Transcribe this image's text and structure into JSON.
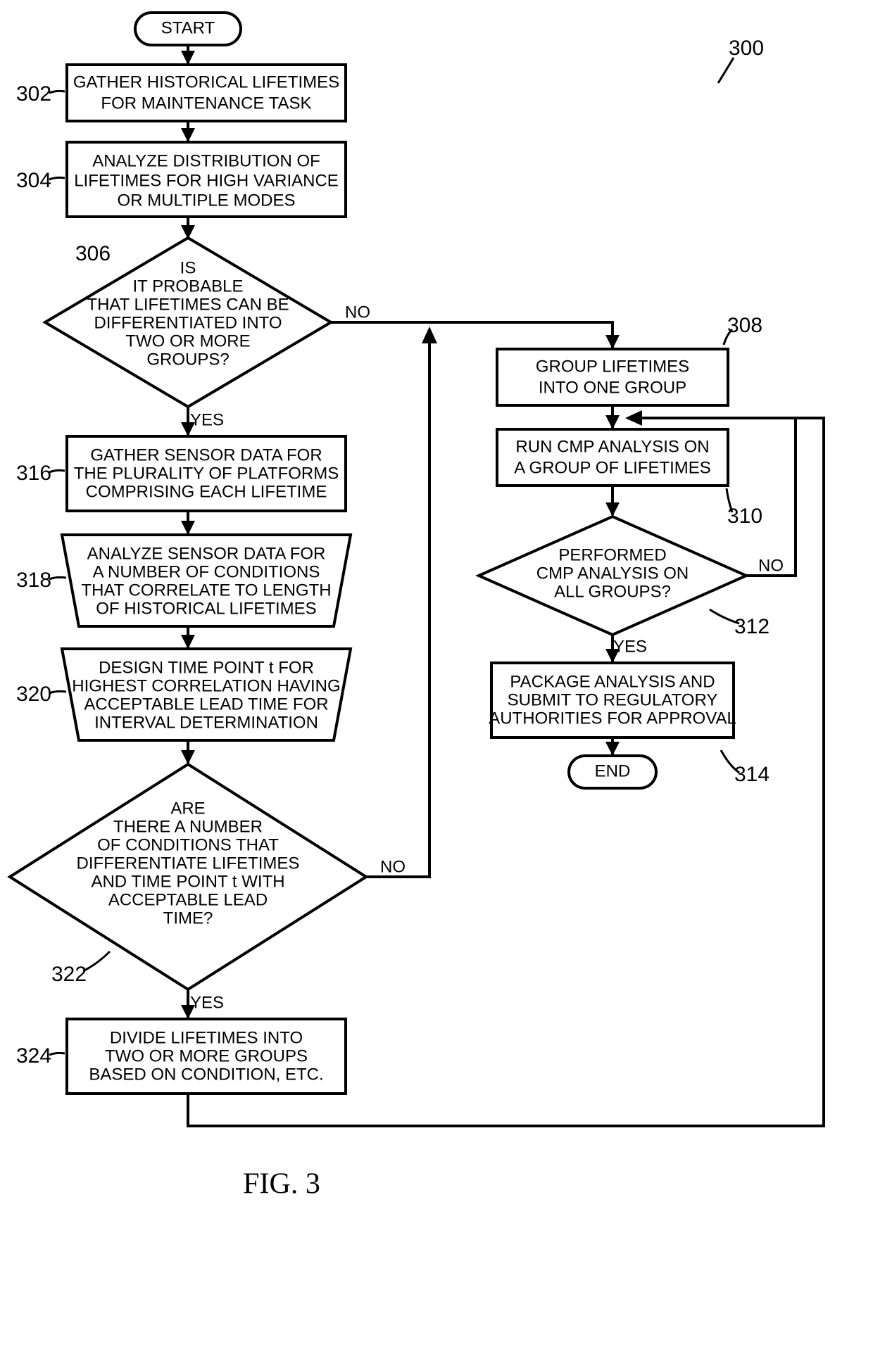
{
  "figure_label": "FIG. 3",
  "figure_ref": "300",
  "nodes": {
    "start": "START",
    "end": "END",
    "n302": "GATHER HISTORICAL LIFETIMES FOR MAINTENANCE TASK",
    "n304": "ANALYZE DISTRIBUTION OF LIFETIMES FOR HIGH VARIANCE OR MULTIPLE MODES",
    "n306": "IS IT PROBABLE THAT LIFETIMES CAN BE DIFFERENTIATED INTO TWO OR MORE GROUPS?",
    "n308": "GROUP LIFETIMES INTO ONE GROUP",
    "n310": "RUN CMP ANALYSIS ON A GROUP OF LIFETIMES",
    "n312": "PERFORMED CMP ANALYSIS ON ALL GROUPS?",
    "n314": "PACKAGE ANALYSIS AND SUBMIT TO REGULATORY AUTHORITIES FOR APPROVAL",
    "n316": "GATHER SENSOR DATA FOR THE PLURALITY OF PLATFORMS COMPRISING EACH LIFETIME",
    "n318": "ANALYZE SENSOR DATA FOR A NUMBER OF CONDITIONS THAT CORRELATE TO LENGTH OF HISTORICAL LIFETIMES",
    "n320": "DESIGN TIME POINT t FOR HIGHEST CORRELATION HAVING ACCEPTABLE LEAD TIME FOR INTERVAL DETERMINATION",
    "n322": "ARE THERE A NUMBER OF CONDITIONS THAT DIFFERENTIATE LIFETIMES AND TIME POINT t WITH ACCEPTABLE LEAD TIME?",
    "n324": "DIVIDE LIFETIMES INTO TWO OR MORE GROUPS BASED ON CONDITION, ETC."
  },
  "refs": {
    "n302": "302",
    "n304": "304",
    "n306": "306",
    "n308": "308",
    "n310": "310",
    "n312": "312",
    "n314": "314",
    "n316": "316",
    "n318": "318",
    "n320": "320",
    "n322": "322",
    "n324": "324"
  },
  "branches": {
    "yes": "YES",
    "no": "NO"
  }
}
